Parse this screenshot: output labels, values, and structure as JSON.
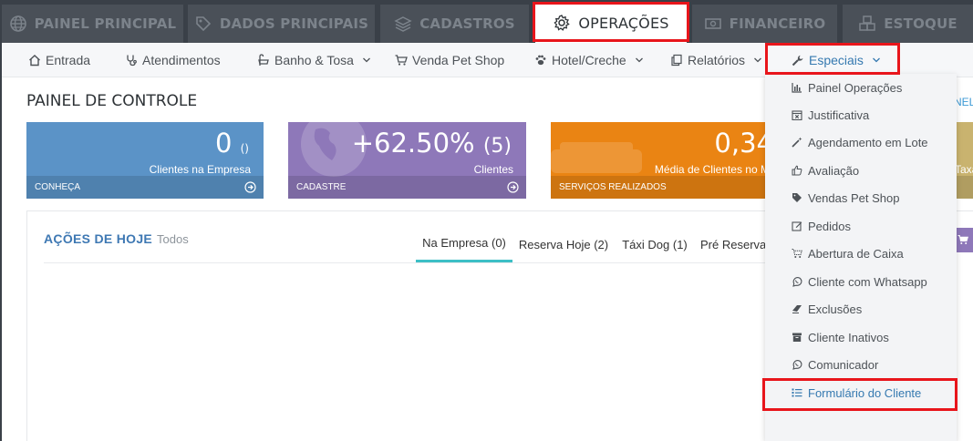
{
  "top_tabs": [
    {
      "label": "PAINEL PRINCIPAL",
      "icon": "globe-icon"
    },
    {
      "label": "DADOS PRINCIPAIS",
      "icon": "tag-icon"
    },
    {
      "label": "CADASTROS",
      "icon": "layers-icon"
    },
    {
      "label": "OPERAÇÕES",
      "icon": "gear-icon",
      "active": true
    },
    {
      "label": "FINANCEIRO",
      "icon": "money-icon"
    },
    {
      "label": "ESTOQUE",
      "icon": "cubes-icon"
    }
  ],
  "subnav": [
    {
      "label": "Entrada",
      "icon": "home-icon"
    },
    {
      "label": "Atendimentos",
      "icon": "stethoscope-icon"
    },
    {
      "label": "Banho & Tosa",
      "icon": "bath-icon",
      "has_caret": true
    },
    {
      "label": "Venda Pet Shop",
      "icon": "cart-icon"
    },
    {
      "label": "Hotel/Creche",
      "icon": "paw-icon",
      "has_caret": true
    },
    {
      "label": "Relatórios",
      "icon": "copy-icon",
      "has_caret": true
    },
    {
      "label": "Especiais",
      "icon": "wrench-icon",
      "has_caret": true,
      "active": true
    }
  ],
  "page": {
    "title": "PAINEL DE CONTROLE",
    "right_link": "NEL"
  },
  "cards": [
    {
      "value": "0",
      "value_small": "()",
      "label": "Clientes na Empresa",
      "footer": "CONHEÇA",
      "color": "#5b93c7"
    },
    {
      "value": "+62.50%",
      "value_small": "(5)",
      "label": "Clientes",
      "footer": "CADASTRE",
      "color": "#8e78b9"
    },
    {
      "value": "0,34",
      "value_small": "",
      "label": "Média de Clientes no M",
      "footer": "SERVIÇOS REALIZADOS",
      "color": "#ea8413"
    },
    {
      "value": "",
      "value_small": "",
      "label": "Taxa",
      "footer": "",
      "color": "#c9b36f"
    }
  ],
  "actions": {
    "title": "AÇÕES DE HOJE",
    "subtitle": "Todos",
    "tabs": [
      {
        "label": "Na Empresa (0)",
        "selected": true
      },
      {
        "label": "Reserva Hoje (2)"
      },
      {
        "label": "Táxi Dog (1)"
      },
      {
        "label": "Pré Reserva"
      }
    ]
  },
  "dropdown": {
    "items": [
      {
        "label": "Painel Operações",
        "icon": "bar-chart-icon"
      },
      {
        "label": "Justificativa",
        "icon": "calendar-x-icon"
      },
      {
        "label": "Agendamento em Lote",
        "icon": "magic-wand-icon"
      },
      {
        "label": "Avaliação",
        "icon": "thumbs-up-icon"
      },
      {
        "label": "Vendas Pet Shop",
        "icon": "tags-icon"
      },
      {
        "label": "Pedidos",
        "icon": "edit-icon"
      },
      {
        "label": "Abertura de Caixa",
        "icon": "cart-icon"
      },
      {
        "label": "Cliente com Whatsapp",
        "icon": "whatsapp-icon"
      },
      {
        "label": "Exclusões",
        "icon": "eraser-icon"
      },
      {
        "label": "Cliente Inativos",
        "icon": "archive-icon"
      },
      {
        "label": "Comunicador",
        "icon": "whatsapp-icon"
      },
      {
        "label": "Formulário do Cliente",
        "icon": "list-icon",
        "highlighted": true
      }
    ]
  },
  "colors": {
    "accent_red": "#e8151b",
    "link_blue": "#3579b0",
    "tab_underline": "#3dbfc6"
  }
}
